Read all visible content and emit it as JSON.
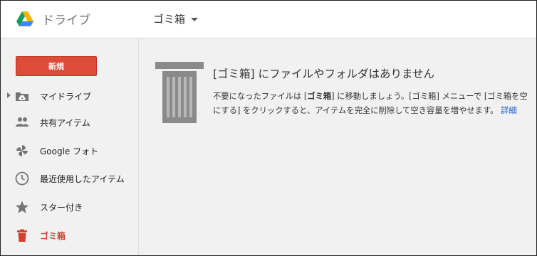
{
  "header": {
    "app_title": "ドライブ",
    "location": "ゴミ箱"
  },
  "sidebar": {
    "new_label": "新規",
    "items": [
      {
        "label": "マイドライブ",
        "icon": "my-drive-icon"
      },
      {
        "label": "共有アイテム",
        "icon": "shared-people-icon"
      },
      {
        "label": "Google フォト",
        "icon": "photos-pinwheel-icon"
      },
      {
        "label": "最近使用したアイテム",
        "icon": "clock-icon"
      },
      {
        "label": "スター付き",
        "icon": "star-icon"
      },
      {
        "label": "ゴミ箱",
        "icon": "trash-icon"
      }
    ]
  },
  "main": {
    "empty_title": "[ゴミ箱] にファイルやフォルダはありません",
    "desc_part1": "不要になったファイルは [",
    "desc_bold": "ゴミ箱",
    "desc_part2": "] に移動しましょう。[ゴミ箱] メニューで [ゴミ箱を空にする] をクリックすると、アイテムを完全に削除して空き容量を増やせます。",
    "details_link": "詳細"
  },
  "colors": {
    "accent_red": "#dd4b39",
    "active_red": "#d23f31",
    "link_blue": "#1155cc",
    "background": "#f1f1f1"
  }
}
